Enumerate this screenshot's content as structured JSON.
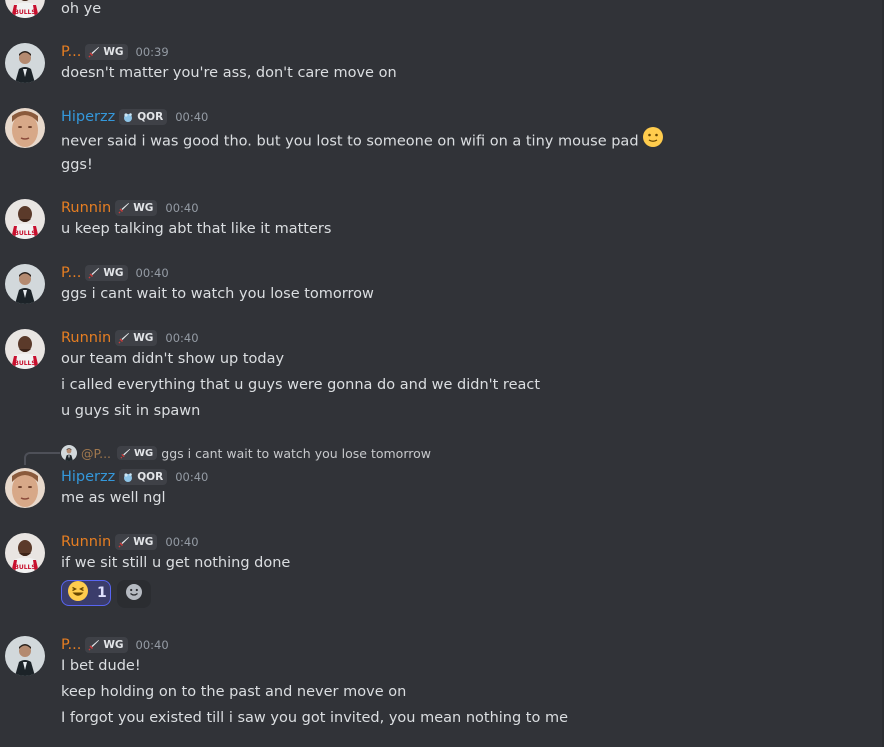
{
  "colors": {
    "background": "#313338",
    "orange_user": "#e67e22",
    "blue_user": "#3498db",
    "time": "#949ba4",
    "text": "#dbdee1",
    "reaction_border": "#5865f2"
  },
  "top_line": {
    "text": "oh ye"
  },
  "users": {
    "p": {
      "name": "P...",
      "tag": "WG",
      "tag_icon": "sword-icon",
      "color": "#e67e22"
    },
    "hiperzz": {
      "name": "Hiperzz",
      "tag": "QOR",
      "tag_icon": "bubble-icon",
      "color": "#3498db"
    },
    "runnin": {
      "name": "Runnin",
      "tag": "WG",
      "tag_icon": "sword-icon",
      "color": "#e67e22"
    }
  },
  "messages": [
    {
      "author": "P...",
      "tag": "WG",
      "time": "00:39",
      "lines": [
        "doesn't matter you're ass, don't care move on"
      ]
    },
    {
      "author": "Hiperzz",
      "tag": "QOR",
      "time": "00:40",
      "lines": [
        "never said i was good tho. but you lost to someone on wifi on a tiny mouse pad",
        "ggs!"
      ],
      "emoji": "slight-smile-emoji"
    },
    {
      "author": "Runnin",
      "tag": "WG",
      "time": "00:40",
      "lines": [
        "u keep talking abt that like it matters"
      ]
    },
    {
      "author": "P...",
      "tag": "WG",
      "time": "00:40",
      "lines": [
        "ggs i cant wait to watch you lose tomorrow"
      ]
    },
    {
      "author": "Runnin",
      "tag": "WG",
      "time": "00:40",
      "lines": [
        "our team didn't show up today",
        "i called everything that u guys were gonna do and we didn't react",
        "u guys sit in spawn"
      ]
    },
    {
      "author": "Hiperzz",
      "tag": "QOR",
      "time": "00:40",
      "lines": [
        "me as well ngl"
      ],
      "reply": {
        "name": "@P...",
        "tag": "WG",
        "text": "ggs i cant wait to watch you lose tomorrow"
      }
    },
    {
      "author": "Runnin",
      "tag": "WG",
      "time": "00:40",
      "lines": [
        "if we sit still u get nothing done"
      ],
      "reaction": {
        "emoji": "laughing-emoji",
        "count": "1"
      },
      "add_reaction": "add-reaction-icon"
    },
    {
      "author": "P...",
      "tag": "WG",
      "time": "00:40",
      "lines": [
        "I bet dude!",
        "keep holding on to the past and never move on",
        "I forgot you existed till i saw you got invited, you mean nothing to me"
      ]
    }
  ]
}
